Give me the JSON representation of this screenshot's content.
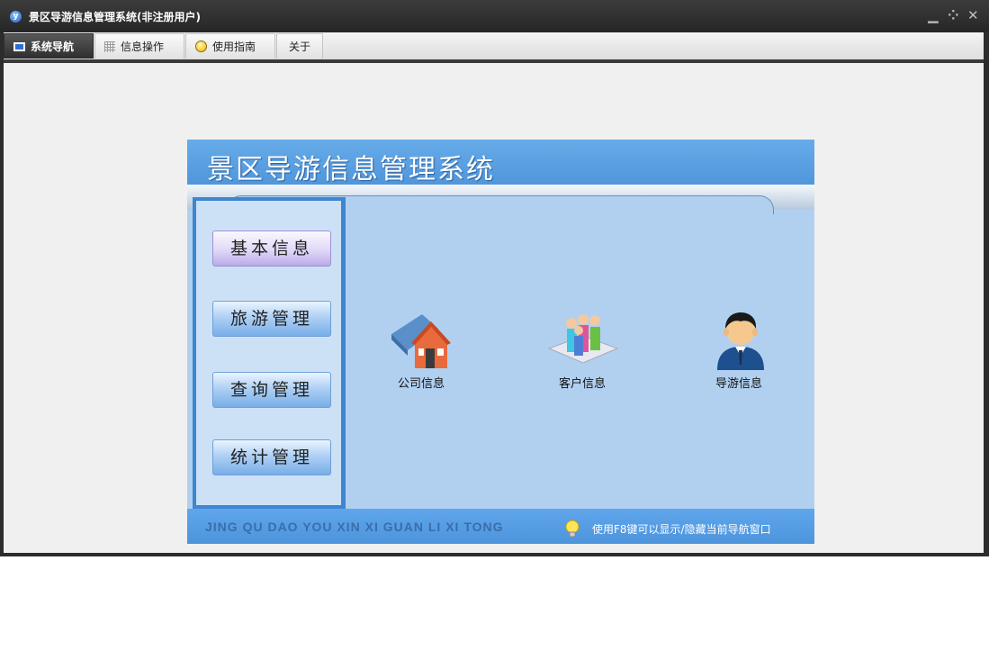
{
  "window": {
    "title": "景区导游信息管理系统(非注册用户)",
    "app_icon": "y",
    "controls": {
      "minimize": "▁",
      "restore": "⁘",
      "close": "✕"
    }
  },
  "tabs": [
    {
      "label": "系统导航",
      "icon": "monitor-icon",
      "active": true
    },
    {
      "label": "信息操作",
      "icon": "grid-icon",
      "active": false
    },
    {
      "label": "使用指南",
      "icon": "bulb-icon",
      "active": false
    },
    {
      "label": "关于",
      "icon": "",
      "active": false
    }
  ],
  "panel": {
    "title": "景区导游信息管理系统",
    "nav_buttons": [
      {
        "label": "基本信息",
        "style": "selected"
      },
      {
        "label": "旅游管理",
        "style": "normal"
      },
      {
        "label": "查询管理",
        "style": "normal"
      },
      {
        "label": "统计管理",
        "style": "normal"
      }
    ],
    "icons": [
      {
        "label": "公司信息",
        "icon": "company-icon"
      },
      {
        "label": "客户信息",
        "icon": "customers-icon"
      },
      {
        "label": "导游信息",
        "icon": "guide-icon"
      }
    ],
    "footer": {
      "pinyin": "JING QU DAO YOU XIN XI GUAN LI XI TONG",
      "hint": "使用F8键可以显示/隐藏当前导航窗口"
    }
  },
  "colors": {
    "header_blue": "#5ea7e8",
    "panel_bg": "#b1d0f0",
    "sidebar_border": "#3e86cf",
    "title_bar": "#2c2c2c"
  }
}
